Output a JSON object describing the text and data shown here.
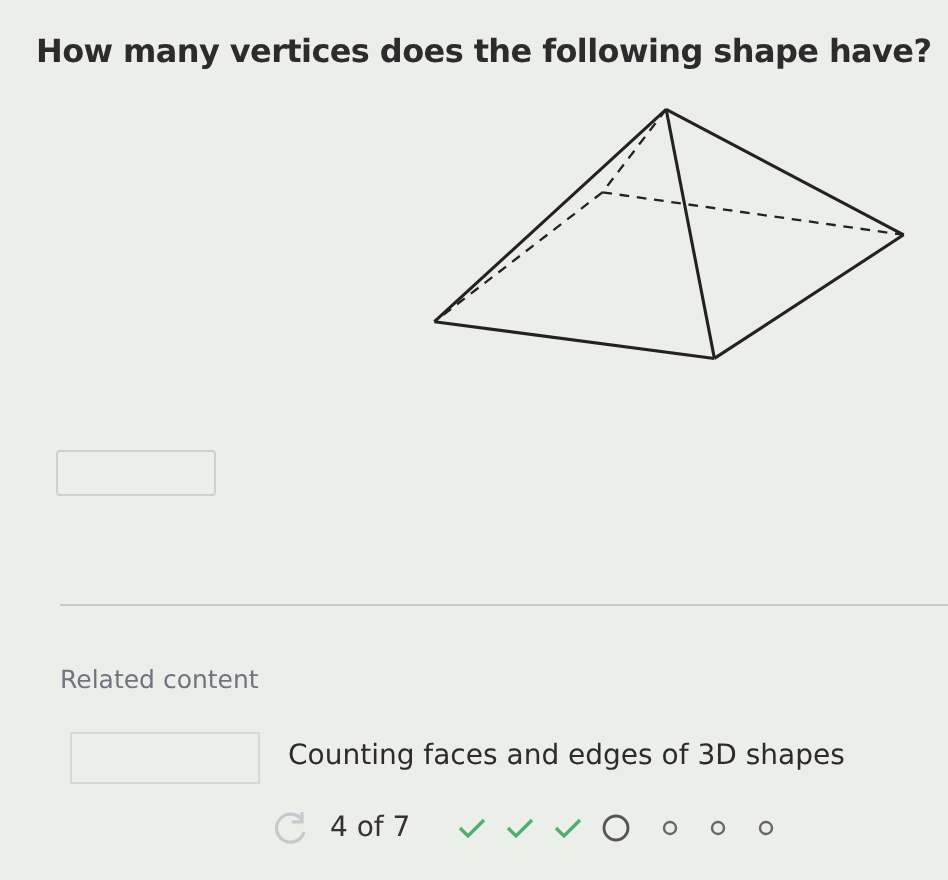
{
  "question": "How many vertices does the following shape have?",
  "answer": {
    "kind": "text-input"
  },
  "related": {
    "title": "Related content",
    "items": [
      {
        "title": "Counting faces and edges of 3D shapes"
      }
    ]
  },
  "progress": {
    "label": "4 of 7",
    "steps": [
      {
        "kind": "done"
      },
      {
        "kind": "done"
      },
      {
        "kind": "done"
      },
      {
        "kind": "current"
      },
      {
        "kind": "upcoming"
      },
      {
        "kind": "upcoming"
      },
      {
        "kind": "upcoming"
      }
    ]
  }
}
